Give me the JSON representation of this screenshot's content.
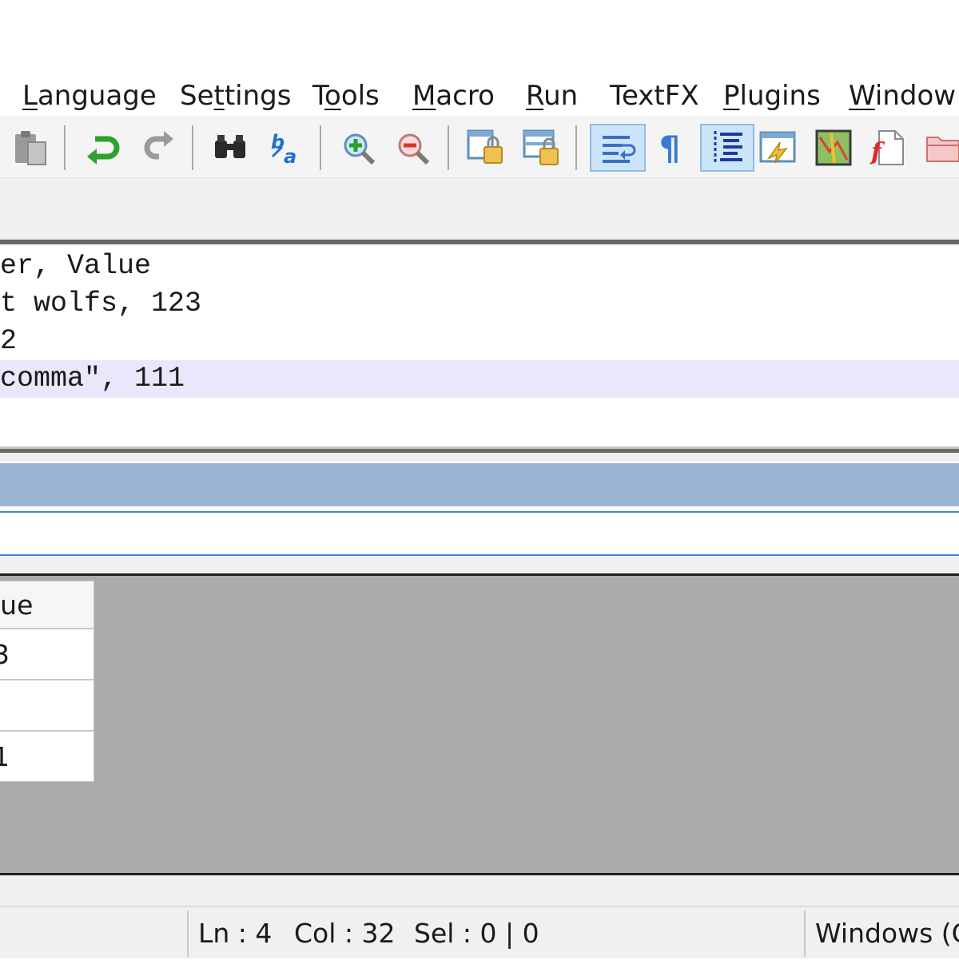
{
  "menubar": {
    "items": [
      {
        "pre": "",
        "ul": "L",
        "post": "anguage"
      },
      {
        "pre": "Se",
        "ul": "t",
        "post": "tings"
      },
      {
        "pre": "T",
        "ul": "o",
        "post": "ols"
      },
      {
        "pre": "",
        "ul": "M",
        "post": "acro"
      },
      {
        "pre": "",
        "ul": "R",
        "post": "un"
      },
      {
        "pre": "TextFX",
        "ul": "",
        "post": ""
      },
      {
        "pre": "",
        "ul": "P",
        "post": "lugins"
      },
      {
        "pre": "",
        "ul": "W",
        "post": "indow"
      }
    ]
  },
  "toolbar": {
    "icons": [
      "paste-icon",
      "undo-icon",
      "redo-icon",
      "find-icon",
      "replace-icon",
      "zoom-in-icon",
      "zoom-out-icon",
      "sync-vertical-icon",
      "sync-horizontal-icon",
      "word-wrap-icon",
      "show-all-chars-icon",
      "indent-guide-icon",
      "define-language-icon",
      "document-map-icon",
      "function-list-icon",
      "folder-icon"
    ],
    "active": [
      "word-wrap-icon",
      "indent-guide-icon"
    ]
  },
  "editor": {
    "lines": [
      "er, Value",
      "t wolfs, 123",
      "2",
      "comma\", 111"
    ],
    "current_line_index": 3
  },
  "grid": {
    "header": "lue",
    "cells": [
      "3",
      "",
      "1"
    ]
  },
  "statusbar": {
    "ln": "Ln : 4",
    "col": "Col : 32",
    "sel": "Sel : 0 | 0",
    "eol": "Windows (C"
  }
}
